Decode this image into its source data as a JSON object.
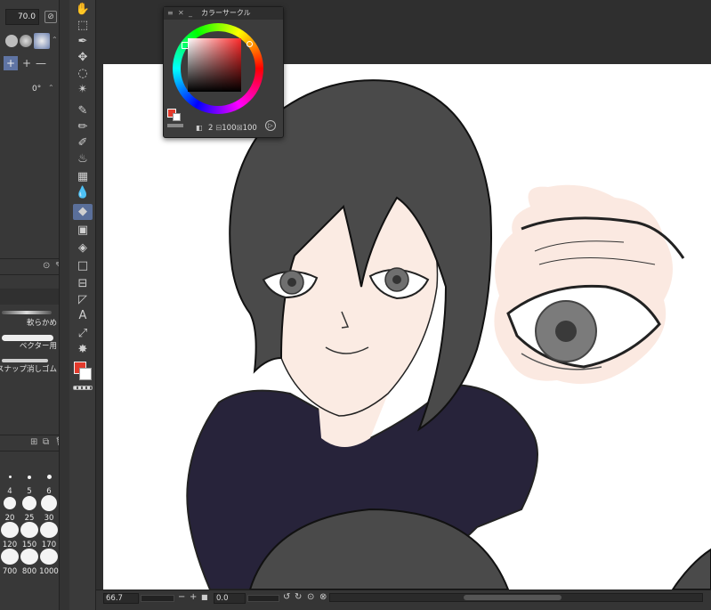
{
  "tool_property": {
    "opacity_value": "70.0",
    "angle_value": "0°"
  },
  "presets": [
    {
      "label": "軟らかめ"
    },
    {
      "label": "ベクター用"
    },
    {
      "label": "スナップ消しゴム"
    }
  ],
  "brush_sizes": [
    "4",
    "5",
    "6",
    "20",
    "25",
    "30",
    "120",
    "150",
    "170",
    "700",
    "800",
    "1000"
  ],
  "color_panel": {
    "title": "カラーサークル",
    "value_a": "2",
    "value_s": "100",
    "value_v": "100",
    "main_color": "#e33a2c",
    "sub_color": "#ffffff"
  },
  "statusbar": {
    "zoom": "66.7",
    "rotation": "0.0"
  },
  "colors": {
    "hair": "#4a4a4a",
    "hoodie": "#27233a",
    "skin": "#fbebe3",
    "eye_bg": "#fbe9e1"
  }
}
